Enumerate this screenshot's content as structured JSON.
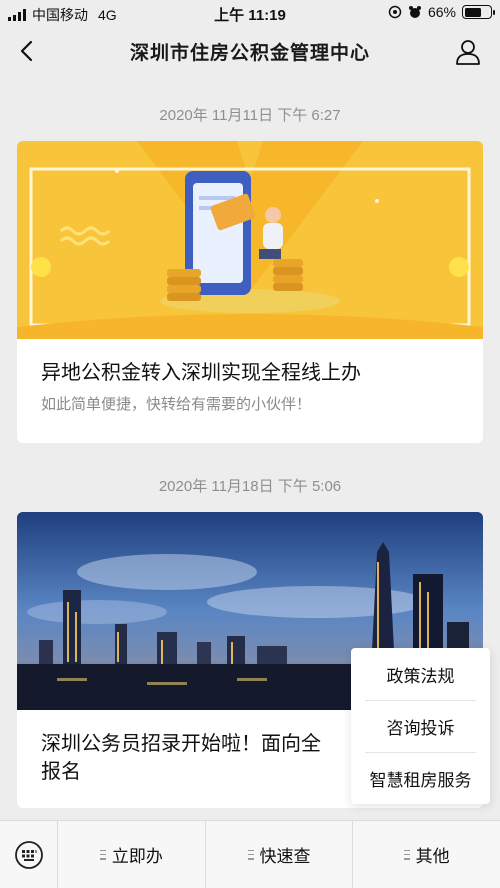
{
  "status_bar": {
    "carrier": "中国移动",
    "network": "4G",
    "time": "上午 11:19",
    "battery_pct": "66%",
    "battery_level": 0.66
  },
  "nav": {
    "title": "深圳市住房公积金管理中心",
    "back_icon": "chevron-left-icon",
    "profile_icon": "person-icon"
  },
  "messages": [
    {
      "timestamp": "2020年 11月11日 下午 6:27",
      "title": "异地公积金转入深圳实现全程线上办",
      "subtitle": "如此简单便捷，快转给有需要的小伙伴！"
    },
    {
      "timestamp": "2020年 11月18日 下午 5:06",
      "title_line1": "深圳公务员招录开始啦！面向全",
      "title_line2": "报名"
    }
  ],
  "popup_menu": {
    "items": [
      "政策法规",
      "咨询投诉",
      "智慧租房服务"
    ]
  },
  "bottom_menu": {
    "keyboard_icon": "keyboard-icon",
    "tabs": [
      "立即办",
      "快速查",
      "其他"
    ]
  },
  "colors": {
    "background": "#ededed",
    "banner_yellow": "#f8c53a",
    "timestamp_gray": "#8f8f8f"
  }
}
